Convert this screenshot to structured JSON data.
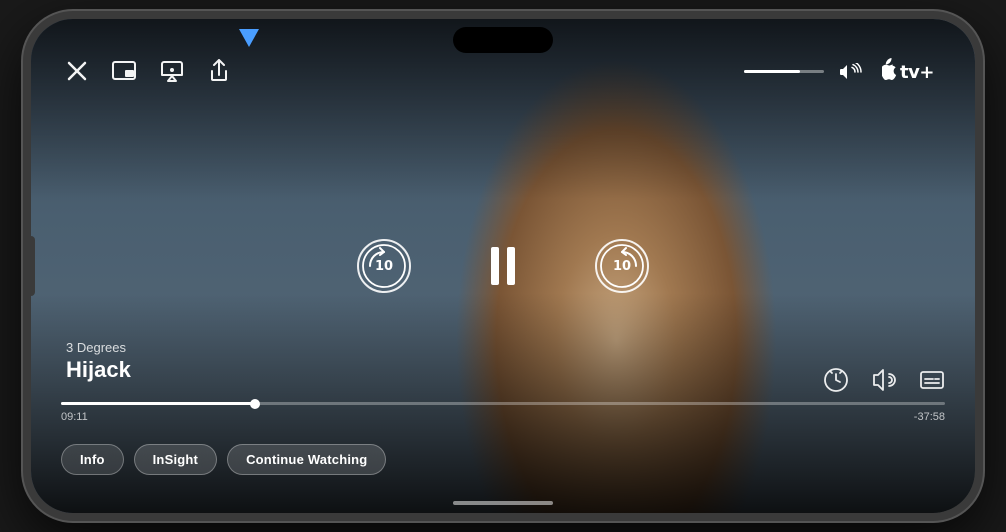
{
  "phone": {
    "dynamic_island": true
  },
  "video": {
    "show_name": "3 Degrees",
    "episode_title": "Hijack",
    "time_current": "09:11",
    "time_remaining": "-37:58",
    "progress_percent": 20,
    "volume_percent": 70
  },
  "appletv": {
    "logo_text": "tv+",
    "apple_symbol": ""
  },
  "controls": {
    "close_icon": "✕",
    "pip_icon": "⧉",
    "airplay_icon": "⬡",
    "share_icon": "↑",
    "volume_icon": "🔊",
    "rewind_label": "10",
    "forward_label": "10",
    "speed_icon": "⊙",
    "audio_icon": "⊙",
    "subtitle_icon": "⊡"
  },
  "buttons": {
    "info_label": "Info",
    "insight_label": "InSight",
    "continue_label": "Continue Watching"
  },
  "arrow": {
    "color": "#4a9eff",
    "pointing_to": "airplay-button"
  }
}
